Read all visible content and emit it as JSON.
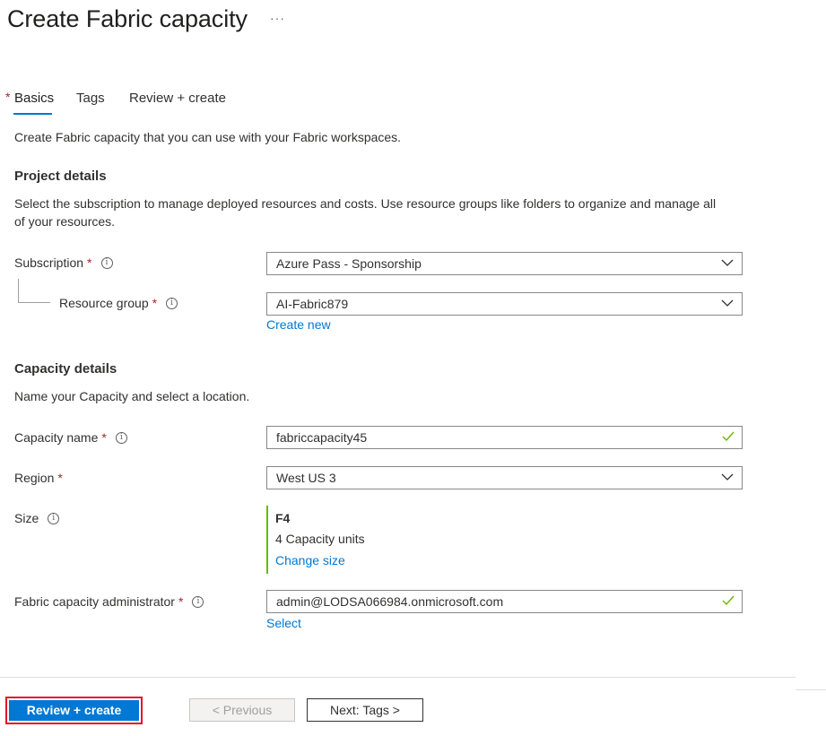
{
  "header": {
    "title": "Create Fabric capacity",
    "more_label": "···"
  },
  "tabs": [
    {
      "label": "Basics",
      "required": "*"
    },
    {
      "label": "Tags"
    },
    {
      "label": "Review + create"
    }
  ],
  "intro": "Create Fabric capacity that you can use with your Fabric workspaces.",
  "project": {
    "heading": "Project details",
    "description_line1": "Select the subscription to manage deployed resources and costs. Use resource groups like folders to organize and manage all",
    "description_line2": "of your resources.",
    "subscription": {
      "label": "Subscription",
      "required": "*",
      "value": "Azure Pass - Sponsorship"
    },
    "resource_group": {
      "label": "Resource group",
      "required": "*",
      "value": "AI-Fabric879",
      "create_new": "Create new"
    }
  },
  "capacity": {
    "heading": "Capacity details",
    "description": "Name your Capacity and select a location.",
    "name": {
      "label": "Capacity name",
      "required": "*",
      "value": "fabriccapacity45"
    },
    "region": {
      "label": "Region",
      "required": "*",
      "value": "West US 3"
    },
    "size": {
      "label": "Size",
      "sku": "F4",
      "units": "4 Capacity units",
      "change": "Change size"
    },
    "admin": {
      "label": "Fabric capacity administrator",
      "required": "*",
      "value": "admin@LODSA066984.onmicrosoft.com",
      "select": "Select"
    }
  },
  "footer": {
    "review_create": "Review + create",
    "previous": "< Previous",
    "next": "Next: Tags >"
  },
  "colors": {
    "accent": "#0078d4",
    "required": "#a4262c",
    "valid": "#6bb700",
    "highlight_border": "#e81123"
  }
}
